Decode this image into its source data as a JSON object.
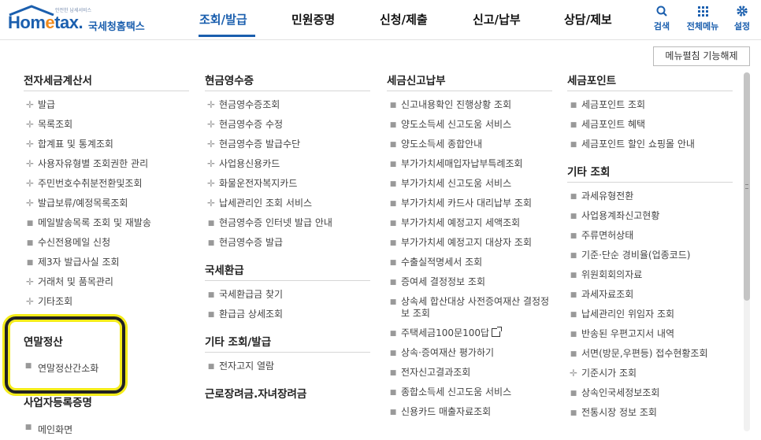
{
  "header": {
    "logo_small": "안전한 납세서비스",
    "logo_word_a": "Hom",
    "logo_word_e": "e",
    "logo_word_b": "tax.",
    "logo_kr": "국세청홈택스",
    "nav": [
      "조회/발급",
      "민원증명",
      "신청/제출",
      "신고/납부",
      "상담/제보"
    ],
    "active_nav": "조회/발급",
    "search_label": "검색",
    "allmenu_label": "전체메뉴",
    "settings_label": "설정",
    "accent_color": "#1b5fae"
  },
  "expand_button": "메뉴펼침 기능해제",
  "columns": [
    {
      "sections": [
        {
          "title": "전자세금계산서",
          "items": [
            {
              "label": "발급",
              "marker": "plus"
            },
            {
              "label": "목록조회",
              "marker": "plus"
            },
            {
              "label": "합계표 및 통계조회",
              "marker": "plus"
            },
            {
              "label": "사용자유형별 조회권한 관리",
              "marker": "plus"
            },
            {
              "label": "주민번호수취분전환및조회",
              "marker": "plus"
            },
            {
              "label": "발급보류/예정목록조회",
              "marker": "plus"
            },
            {
              "label": "메일발송목록 조회 및 재발송",
              "marker": "dot"
            },
            {
              "label": "수신전용메일 신청",
              "marker": "dot"
            },
            {
              "label": "제3자 발급사실 조회",
              "marker": "dot"
            },
            {
              "label": "거래처 및 품목관리",
              "marker": "plus"
            },
            {
              "label": "기타조회",
              "marker": "plus"
            }
          ]
        }
      ]
    },
    {
      "sections": [
        {
          "title": "현금영수증",
          "items": [
            {
              "label": "현금영수증조회",
              "marker": "plus"
            },
            {
              "label": "현금영수증 수정",
              "marker": "plus"
            },
            {
              "label": "현금영수증 발급수단",
              "marker": "plus"
            },
            {
              "label": "사업용신용카드",
              "marker": "plus"
            },
            {
              "label": "화물운전자복지카드",
              "marker": "plus"
            },
            {
              "label": "납세관리인 조회 서비스",
              "marker": "plus"
            },
            {
              "label": "현금영수증 인터넷 발급 안내",
              "marker": "dot"
            },
            {
              "label": "현금영수증 발급",
              "marker": "dot"
            }
          ]
        },
        {
          "title": "국세환급",
          "items": [
            {
              "label": "국세환급금 찾기",
              "marker": "dot"
            },
            {
              "label": "환급금 상세조회",
              "marker": "dot"
            }
          ]
        },
        {
          "title": "기타 조회/발급",
          "items": [
            {
              "label": "전자고지 열람",
              "marker": "dot"
            }
          ]
        },
        {
          "title": "근로장려금.자녀장려금",
          "items": []
        }
      ]
    },
    {
      "sections": [
        {
          "title": "세금신고납부",
          "items": [
            {
              "label": "신고내용확인 진행상황 조회",
              "marker": "dot"
            },
            {
              "label": "양도소득세 신고도움 서비스",
              "marker": "dot"
            },
            {
              "label": "양도소득세 종합안내",
              "marker": "dot"
            },
            {
              "label": "부가가치세매입자납부특례조회",
              "marker": "dot"
            },
            {
              "label": "부가가치세 신고도움 서비스",
              "marker": "dot"
            },
            {
              "label": "부가가치세 카드사 대리납부 조회",
              "marker": "dot"
            },
            {
              "label": "부가가치세 예정고지 세액조회",
              "marker": "dot"
            },
            {
              "label": "부가가치세 예정고지 대상자 조회",
              "marker": "dot"
            },
            {
              "label": "수출실적명세서 조회",
              "marker": "dot"
            },
            {
              "label": "증여세 결정정보 조회",
              "marker": "dot"
            },
            {
              "label": "상속세 합산대상 사전증여재산 결정정보 조회",
              "marker": "dot",
              "wrap": true
            },
            {
              "label": "주택세금100문100답",
              "marker": "dot",
              "external": true
            },
            {
              "label": "상속·증여재산 평가하기",
              "marker": "dot"
            },
            {
              "label": "전자신고결과조회",
              "marker": "dot"
            },
            {
              "label": "종합소득세 신고도움 서비스",
              "marker": "dot"
            },
            {
              "label": "신용카드 매출자료조회",
              "marker": "dot"
            }
          ]
        }
      ]
    },
    {
      "sections": [
        {
          "title": "세금포인트",
          "items": [
            {
              "label": "세금포인트 조회",
              "marker": "dot"
            },
            {
              "label": "세금포인트 혜택",
              "marker": "dot"
            },
            {
              "label": "세금포인트 할인 쇼핑몰 안내",
              "marker": "dot"
            }
          ]
        },
        {
          "title": "기타 조회",
          "items": [
            {
              "label": "과세유형전환",
              "marker": "dot"
            },
            {
              "label": "사업용계좌신고현황",
              "marker": "dot"
            },
            {
              "label": "주류면허상태",
              "marker": "dot"
            },
            {
              "label": "기준·단순 경비율(업종코드)",
              "marker": "dot"
            },
            {
              "label": "위원회회의자료",
              "marker": "dot"
            },
            {
              "label": "과세자료조회",
              "marker": "dot"
            },
            {
              "label": "납세관리인 위임자 조회",
              "marker": "dot"
            },
            {
              "label": "반송된 우편고지서 내역",
              "marker": "dot"
            },
            {
              "label": "서면(방문,우편등) 접수현황조회",
              "marker": "dot"
            },
            {
              "label": "기준시가 조회",
              "marker": "plus"
            },
            {
              "label": "상속인국세정보조회",
              "marker": "dot"
            },
            {
              "label": "전통시장 정보 조회",
              "marker": "dot"
            }
          ]
        }
      ]
    }
  ],
  "highlight": {
    "title": "연말정산",
    "item": "연말정산간소화",
    "border_color": "#222222",
    "glow_color": "#f4ec1a"
  },
  "below_highlight": {
    "title": "사업자등록증명",
    "item": "메인화면"
  }
}
